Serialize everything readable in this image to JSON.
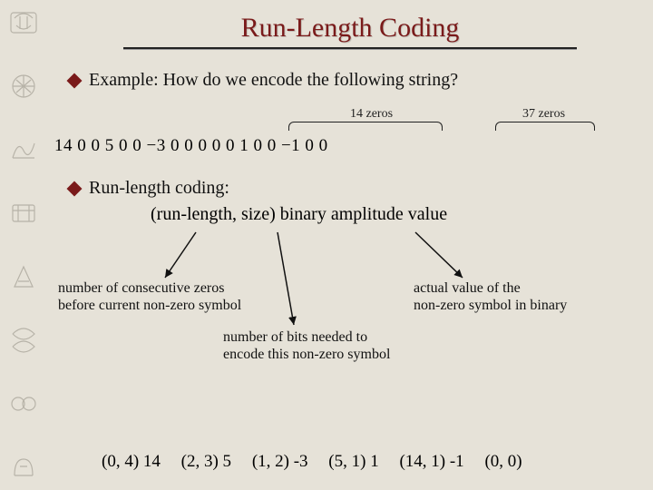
{
  "title": "Run-Length Coding",
  "bullets": {
    "b1": "Example: How do we encode the following string?",
    "b2": "Run-length coding:"
  },
  "brace_labels": {
    "g1": "14 zeros",
    "g2": "37 zeros"
  },
  "sequence": "14   0   0   5   0   0   −3   0   0   0   0   0   1   0          0   −1   0          0",
  "format_line": "(run-length, size) binary amplitude value",
  "notes": {
    "left_l1": "number of consecutive zeros",
    "left_l2": "before current non-zero symbol",
    "right_l1": "actual value of the",
    "right_l2": "non-zero symbol in binary",
    "mid_l1": "number of bits needed to",
    "mid_l2": "encode this non-zero symbol"
  },
  "encoded": {
    "e0": "(0, 4) 14",
    "e1": "(2, 3) 5",
    "e2": "(1, 2) -3",
    "e3": "(5, 1) 1",
    "e4": "(14, 1) -1",
    "e5": "(0, 0)"
  }
}
